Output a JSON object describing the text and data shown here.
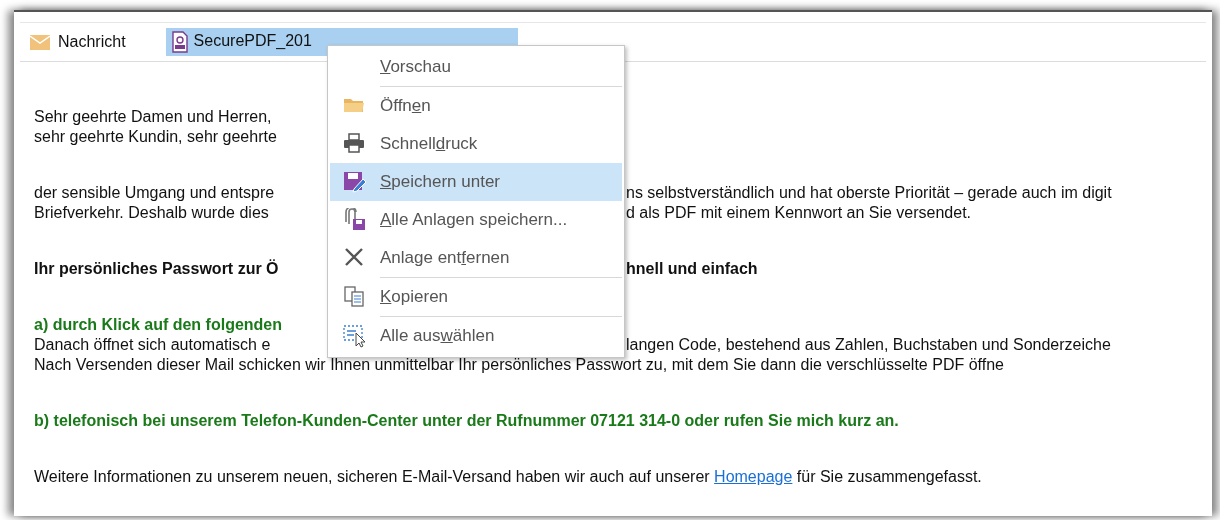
{
  "attachment_bar": {
    "message_tab": {
      "label": "Nachricht",
      "selected": false
    },
    "attachment": {
      "label": "SecurePDF_201",
      "selected": true
    }
  },
  "body_lines": [
    {
      "kind": "plain",
      "left": "Sehr geehrte Damen und Herren,"
    },
    {
      "kind": "plain",
      "left": "sehr geehrte Kundin, sehr geehrte"
    },
    {
      "kind": "blank"
    },
    {
      "kind": "plain",
      "left": "der sensible Umgang und entspre",
      "right": "ns selbstverständlich und hat oberste Priorität – gerade auch im digit"
    },
    {
      "kind": "plain",
      "left": "Briefverkehr. Deshalb wurde dies",
      "right": "d als PDF mit einem Kennwort an Sie versendet."
    },
    {
      "kind": "blank"
    },
    {
      "kind": "bold",
      "left": "Ihr persönliches Passwort zur Ö",
      "right": "hnell und einfach"
    },
    {
      "kind": "blank"
    },
    {
      "kind": "green",
      "left": "a) durch Klick auf den folgenden"
    },
    {
      "kind": "plain",
      "left": "Danach öffnet sich automatisch e",
      "right": "langen Code, bestehend aus Zahlen, Buchstaben und Sonderzeiche"
    },
    {
      "kind": "full",
      "text": "Nach Versenden dieser Mail schicken wir Ihnen unmittelbar Ihr persönliches Passwort zu, mit dem Sie dann die verschlüsselte PDF öffne"
    },
    {
      "kind": "blank"
    },
    {
      "kind": "green_full",
      "text": "b) telefonisch bei unserem Telefon-Kunden-Center unter der Rufnummer 07121 314-0 oder rufen Sie mich kurz an."
    },
    {
      "kind": "blank"
    },
    {
      "kind": "link_line",
      "before": "Weitere Informationen zu unserem neuen, sicheren E-Mail-Versand haben wir auch auf unserer",
      "link": "Homepage",
      "after": "für Sie zusammengefasst."
    }
  ],
  "context_menu": [
    {
      "kind": "none",
      "key": "V",
      "after": "orschau",
      "selected": false,
      "separator_after": true
    },
    {
      "kind": "folder",
      "before": "Öffn",
      "key": "e",
      "after": "n",
      "selected": false,
      "separator_after": false
    },
    {
      "kind": "printer",
      "before": "Schnell",
      "key": "d",
      "after": "ruck",
      "selected": false,
      "separator_after": false
    },
    {
      "kind": "save",
      "key": "S",
      "after": "peichern unter",
      "selected": true,
      "separator_after": false
    },
    {
      "kind": "save_all",
      "key": "A",
      "after": "lle Anlagen speichern...",
      "selected": false,
      "separator_after": false
    },
    {
      "kind": "remove",
      "before": "Anlage ent",
      "key": "f",
      "after": "ernen",
      "selected": false,
      "separator_after": true
    },
    {
      "kind": "copy",
      "key": "K",
      "after": "opieren",
      "selected": false,
      "separator_after": true
    },
    {
      "kind": "select_all",
      "before": "Alle aus",
      "key": "w",
      "after": "ählen",
      "selected": false,
      "separator_after": false
    }
  ]
}
